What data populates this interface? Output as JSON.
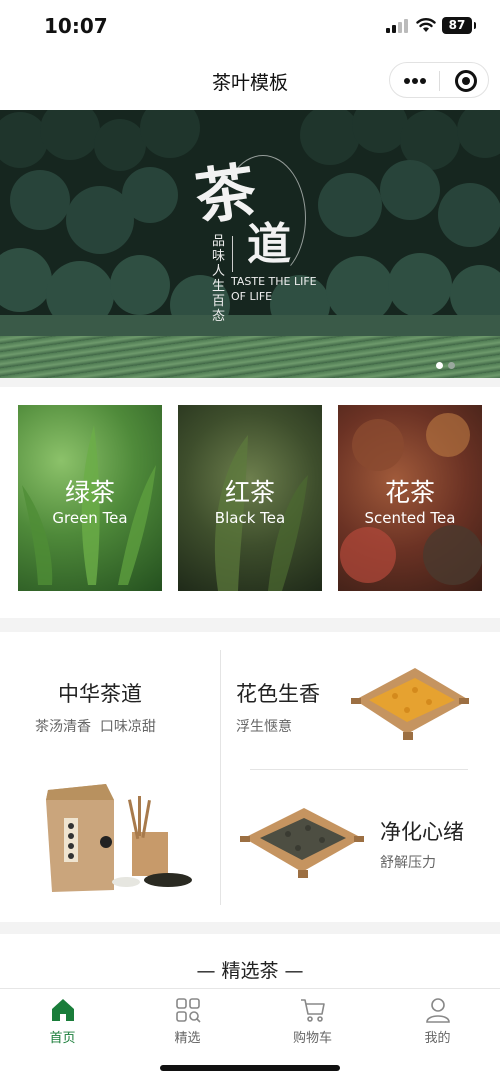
{
  "status_bar": {
    "time": "10:07",
    "battery": "87"
  },
  "nav": {
    "title": "茶叶模板"
  },
  "banner": {
    "calligraphy_main": "茶",
    "calligraphy_second": "道",
    "vertical_text": "品味人生百态",
    "english_text": "TASTE THE LIFE OF LIFE",
    "active_dot_color": "#ffffff",
    "inactive_dot_color": "#9aa89e",
    "dots": [
      "active",
      "inactive"
    ]
  },
  "categories": [
    {
      "cn": "绿茶",
      "en": "Green Tea"
    },
    {
      "cn": "红茶",
      "en": "Black Tea"
    },
    {
      "cn": "花茶",
      "en": "Scented Tea"
    }
  ],
  "features": {
    "left": {
      "title": "中华茶道",
      "subtitle": "茶汤清香  口味凉甜"
    },
    "top_right": {
      "title": "花色生香",
      "subtitle": "浮生惬意"
    },
    "bottom_right": {
      "title": "净化心绪",
      "subtitle": "舒解压力"
    }
  },
  "selected_section": {
    "title": "— 精选茶 —"
  },
  "tab_bar": {
    "active_color": "#1a7d3a",
    "items": [
      {
        "label": "首页",
        "icon": "home-icon",
        "active": true
      },
      {
        "label": "精选",
        "icon": "grid-search-icon",
        "active": false
      },
      {
        "label": "购物车",
        "icon": "cart-icon",
        "active": false
      },
      {
        "label": "我的",
        "icon": "user-icon",
        "active": false
      }
    ]
  }
}
